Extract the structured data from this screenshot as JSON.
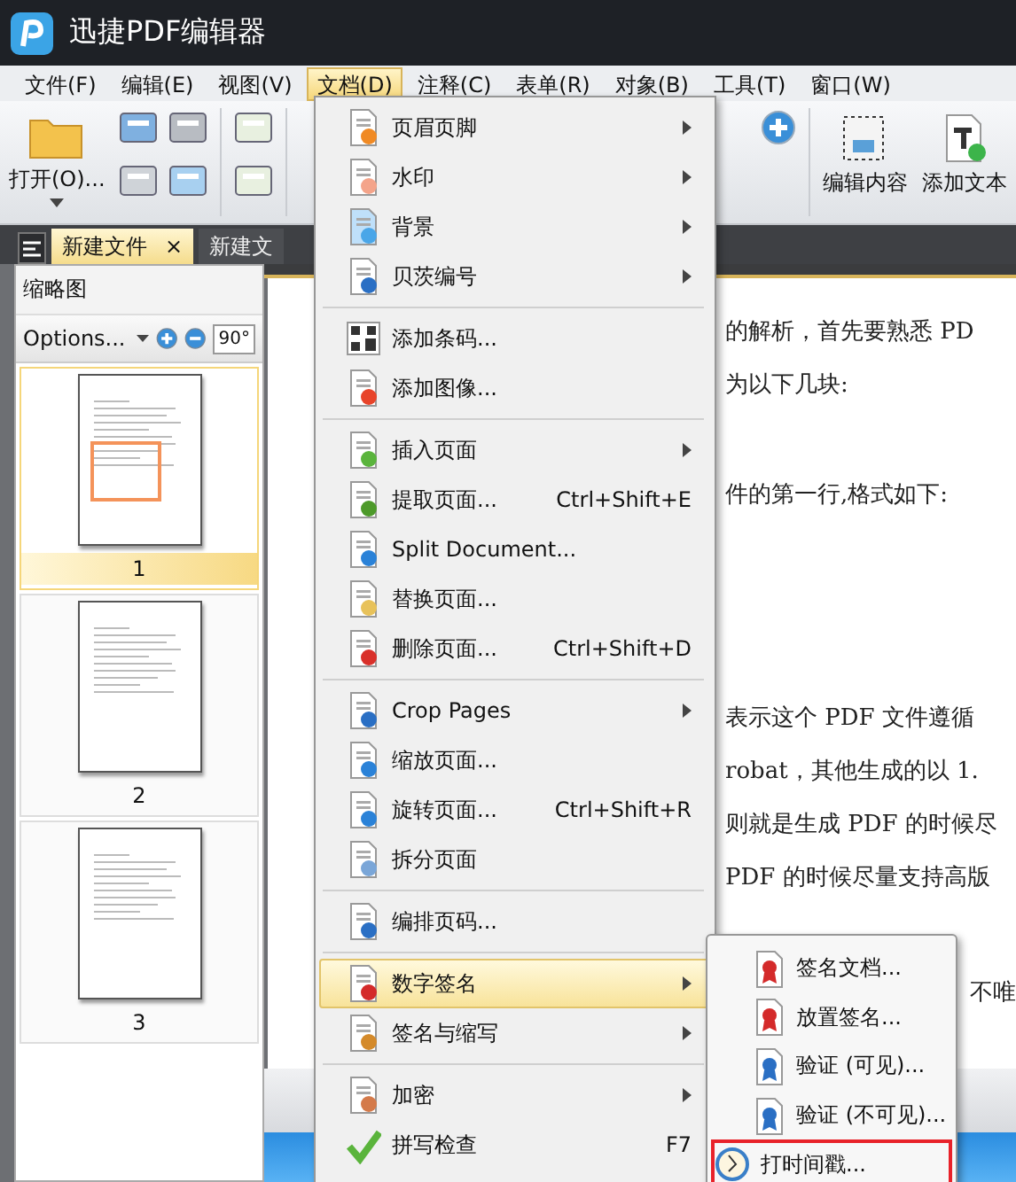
{
  "window": {
    "title": "迅捷PDF编辑器"
  },
  "menubar": [
    {
      "label": "文件(F)",
      "selected": false
    },
    {
      "label": "编辑(E)",
      "selected": false
    },
    {
      "label": "视图(V)",
      "selected": false
    },
    {
      "label": "文档(D)",
      "selected": true
    },
    {
      "label": "注释(C)",
      "selected": false
    },
    {
      "label": "表单(R)",
      "selected": false
    },
    {
      "label": "对象(B)",
      "selected": false
    },
    {
      "label": "工具(T)",
      "selected": false
    },
    {
      "label": "窗口(W)",
      "selected": false
    }
  ],
  "toolbar": {
    "open": "打开(O)...",
    "edit_content": "编辑内容",
    "add_text": "添加文本"
  },
  "tabs": [
    {
      "label": "新建文件",
      "selected": true,
      "close": "×"
    },
    {
      "label": "新建文",
      "selected": false
    }
  ],
  "thumbnail_panel": {
    "title": "缩略图",
    "options": "Options...",
    "rotate": "90°",
    "pages": [
      {
        "label": "1",
        "selected": true
      },
      {
        "label": "2",
        "selected": false
      },
      {
        "label": "3",
        "selected": false
      }
    ]
  },
  "document_lines": [
    "的解析，首先要熟悉 PD",
    "为以下几块:",
    "件的第一行,格式如下:",
    "表示这个 PDF 文件遵循",
    "robat，其他生成的以 1.",
    "则就是生成 PDF 的时候尽",
    "PDF 的时候尽量支持高版",
    "不唯"
  ],
  "menu": [
    [
      {
        "label": "页眉页脚",
        "submenu": true,
        "selected": false
      },
      {
        "label": "水印",
        "submenu": true,
        "selected": false
      },
      {
        "label": "背景",
        "submenu": true,
        "selected": false
      },
      {
        "label": "贝茨编号",
        "submenu": true,
        "selected": false
      }
    ],
    [
      {
        "label": "添加条码...",
        "submenu": false,
        "selected": false
      },
      {
        "label": "添加图像...",
        "submenu": false,
        "selected": false
      }
    ],
    [
      {
        "label": "插入页面",
        "submenu": true,
        "selected": false
      },
      {
        "label": "提取页面...",
        "shortcut": "Ctrl+Shift+E",
        "submenu": false,
        "selected": false
      },
      {
        "label": "Split Document...",
        "submenu": false,
        "selected": false
      },
      {
        "label": "替换页面...",
        "submenu": false,
        "selected": false
      },
      {
        "label": "删除页面...",
        "shortcut": "Ctrl+Shift+D",
        "submenu": false,
        "selected": false
      }
    ],
    [
      {
        "label": "Crop Pages",
        "submenu": true,
        "selected": false
      },
      {
        "label": "缩放页面...",
        "submenu": false,
        "selected": false
      },
      {
        "label": "旋转页面...",
        "shortcut": "Ctrl+Shift+R",
        "submenu": false,
        "selected": false
      },
      {
        "label": "拆分页面",
        "submenu": false,
        "selected": false
      }
    ],
    [
      {
        "label": "编排页码...",
        "submenu": false,
        "selected": false
      }
    ],
    [
      {
        "label": "数字签名",
        "submenu": true,
        "selected": true
      },
      {
        "label": "签名与缩写",
        "submenu": true,
        "selected": false
      }
    ],
    [
      {
        "label": "加密",
        "submenu": true,
        "selected": false
      },
      {
        "label": "拼写检查",
        "shortcut": "F7",
        "submenu": false,
        "selected": false
      }
    ]
  ],
  "submenu": [
    {
      "label": "签名文档...",
      "highlighted": false
    },
    {
      "label": "放置签名...",
      "highlighted": false
    },
    {
      "label": "验证 (可见)...",
      "highlighted": false
    },
    {
      "label": "验证 (不可见)...",
      "highlighted": false
    },
    {
      "label": "打时间戳...",
      "highlighted": true
    }
  ]
}
